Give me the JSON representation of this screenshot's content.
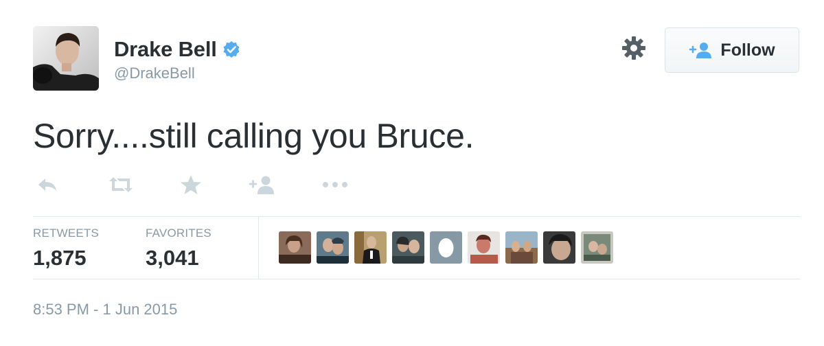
{
  "user": {
    "display_name": "Drake Bell",
    "handle": "@DrakeBell",
    "verified": true,
    "avatar": "profile-photo-icon"
  },
  "follow_button": {
    "label": "Follow",
    "icon": "add-user-icon"
  },
  "settings_icon": "gear-icon",
  "tweet": {
    "text": "Sorry....still calling you Bruce.",
    "timestamp": "8:53 PM - 1 Jun 2015"
  },
  "actions": [
    {
      "name": "reply",
      "icon": "reply-icon"
    },
    {
      "name": "retweet",
      "icon": "retweet-icon"
    },
    {
      "name": "favorite",
      "icon": "star-icon"
    },
    {
      "name": "follow",
      "icon": "add-user-icon"
    },
    {
      "name": "more",
      "icon": "more-dots-icon"
    }
  ],
  "stats": {
    "retweets_label": "RETWEETS",
    "retweets_value": "1,875",
    "favorites_label": "FAVORITES",
    "favorites_value": "3,041"
  },
  "favoriter_avatar_count": 9,
  "colors": {
    "text": "#292f33",
    "secondary": "#8899a6",
    "verified": "#55acee",
    "icon_muted": "#ccd6dd",
    "divider": "#e1e8ed"
  }
}
